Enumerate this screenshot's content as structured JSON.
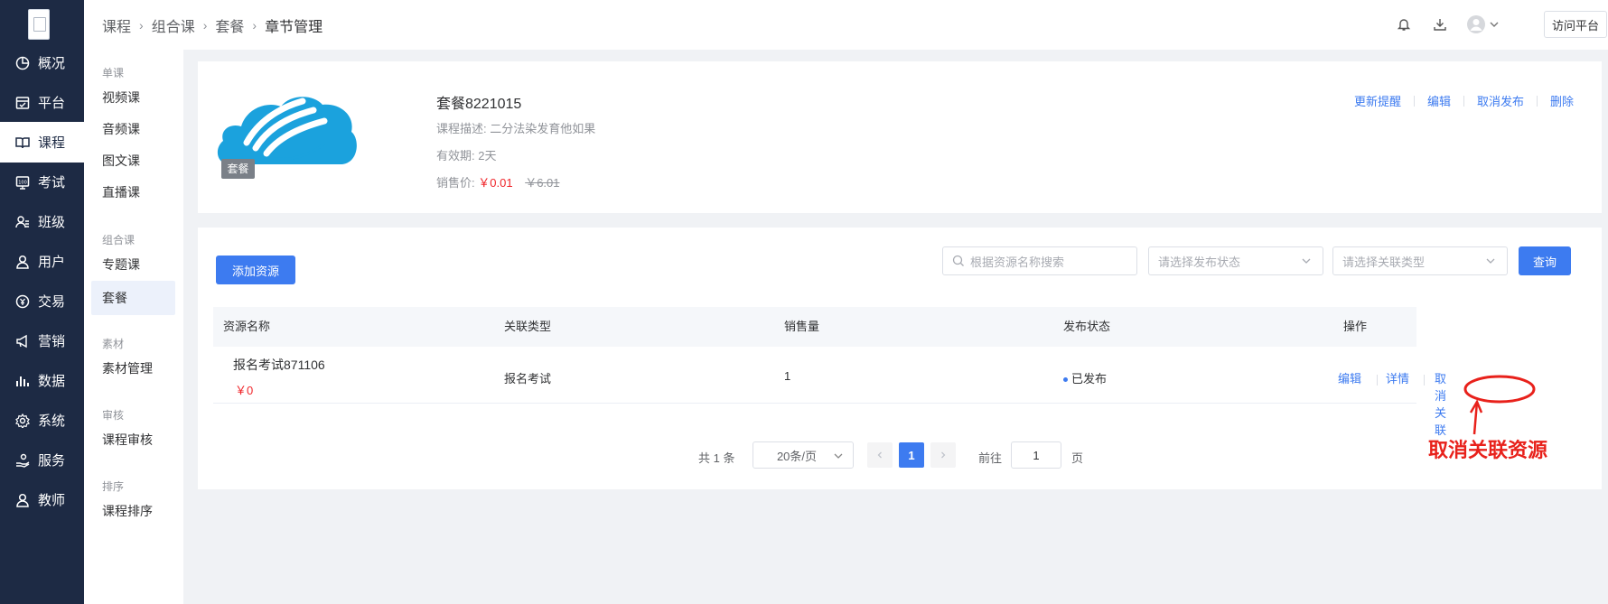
{
  "nav": {
    "items": [
      {
        "label": "概况",
        "icon": "pie-chart-icon"
      },
      {
        "label": "平台",
        "icon": "storefront-icon"
      },
      {
        "label": "课程",
        "icon": "book-icon"
      },
      {
        "label": "考试",
        "icon": "exam-monitor-icon"
      },
      {
        "label": "班级",
        "icon": "class-group-icon"
      },
      {
        "label": "用户",
        "icon": "user-icon"
      },
      {
        "label": "交易",
        "icon": "coin-icon"
      },
      {
        "label": "营销",
        "icon": "megaphone-icon"
      },
      {
        "label": "数据",
        "icon": "bar-chart-icon"
      },
      {
        "label": "系统",
        "icon": "gear-icon"
      },
      {
        "label": "服务",
        "icon": "hand-service-icon"
      },
      {
        "label": "教师",
        "icon": "teacher-icon"
      }
    ],
    "active_index": 2
  },
  "submenu": {
    "groups": [
      {
        "title": "单课",
        "items": [
          "视频课",
          "音频课",
          "图文课",
          "直播课"
        ]
      },
      {
        "title": "组合课",
        "items": [
          "专题课",
          "套餐"
        ]
      },
      {
        "title": "素材",
        "items": [
          "素材管理"
        ]
      },
      {
        "title": "审核",
        "items": [
          "课程审核"
        ]
      },
      {
        "title": "排序",
        "items": [
          "课程排序"
        ]
      }
    ],
    "active": "套餐"
  },
  "header": {
    "breadcrumb": [
      "课程",
      "组合课",
      "套餐",
      "章节管理"
    ],
    "visit_label": "访问平台"
  },
  "package": {
    "cover_tag": "套餐",
    "title": "套餐8221015",
    "description": "课程描述: 二分法染发育他如果",
    "validity": "有效期: 2天",
    "price_label": "销售价:",
    "price": "￥0.01",
    "original_price": "￥6.01",
    "actions": [
      "更新提醒",
      "编辑",
      "取消发布",
      "删除"
    ]
  },
  "toolbar": {
    "add_label": "添加资源",
    "search_placeholder": "根据资源名称搜索",
    "status_placeholder": "请选择发布状态",
    "type_placeholder": "请选择关联类型",
    "query_label": "查询"
  },
  "table": {
    "headers": [
      "资源名称",
      "关联类型",
      "销售量",
      "发布状态",
      "操作"
    ],
    "rows": [
      {
        "name": "报名考试871106",
        "price": "￥0",
        "type": "报名考试",
        "sales": "1",
        "status": "已发布",
        "actions": [
          "编辑",
          "详情",
          "取消关联"
        ]
      }
    ]
  },
  "pagination": {
    "total": "共 1 条",
    "page_size": "20条/页",
    "current_page": "1",
    "goto_label": "前往",
    "goto_value": "1",
    "page_suffix": "页"
  },
  "annotation": {
    "text": "取消关联资源",
    "color": "#e8211b"
  },
  "colors": {
    "nav_bg": "#1d2a44",
    "primary": "#3d7bf0",
    "price": "#f0262b"
  }
}
